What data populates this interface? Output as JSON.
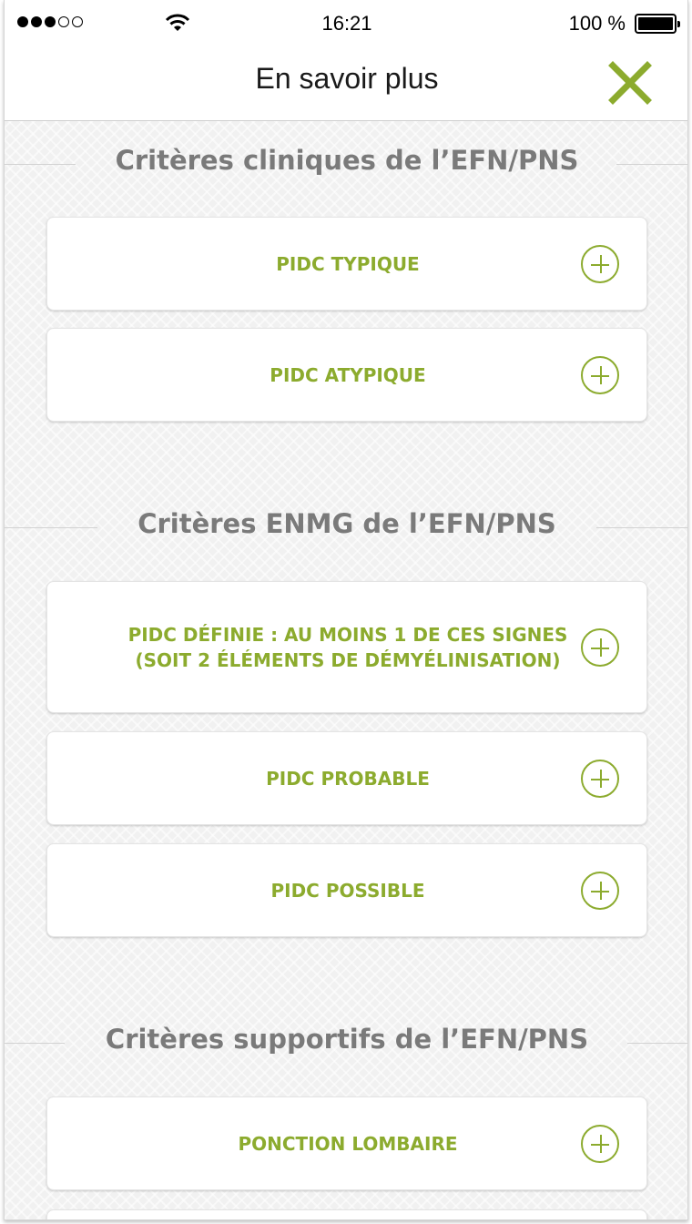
{
  "status_bar": {
    "time": "16:21",
    "battery_percent": "100 %",
    "signal_bars_filled": 3,
    "signal_bars_total": 5
  },
  "nav": {
    "title": "En savoir plus",
    "close_icon": "close-x-icon",
    "accent_color": "#8cab2e"
  },
  "sections": [
    {
      "title": "Critères cliniques de l’EFN/PNS",
      "items": [
        {
          "label": "PIDC TYPIQUE"
        },
        {
          "label": "PIDC ATYPIQUE"
        }
      ]
    },
    {
      "title": "Critères ENMG de l’EFN/PNS",
      "items": [
        {
          "label": "PIDC DÉFINIE : AU MOINS 1 DE CES SIGNES (SOIT 2 ÉLÉMENTS DE DÉMYÉLINISATION)"
        },
        {
          "label": "PIDC PROBABLE"
        },
        {
          "label": "PIDC POSSIBLE"
        }
      ]
    },
    {
      "title": "Critères supportifs de l’EFN/PNS",
      "items": [
        {
          "label": "PONCTION LOMBAIRE"
        }
      ]
    }
  ],
  "colors": {
    "accent": "#8cab2e",
    "section_title": "#7a7a7a",
    "background": "#f1f1f1"
  }
}
